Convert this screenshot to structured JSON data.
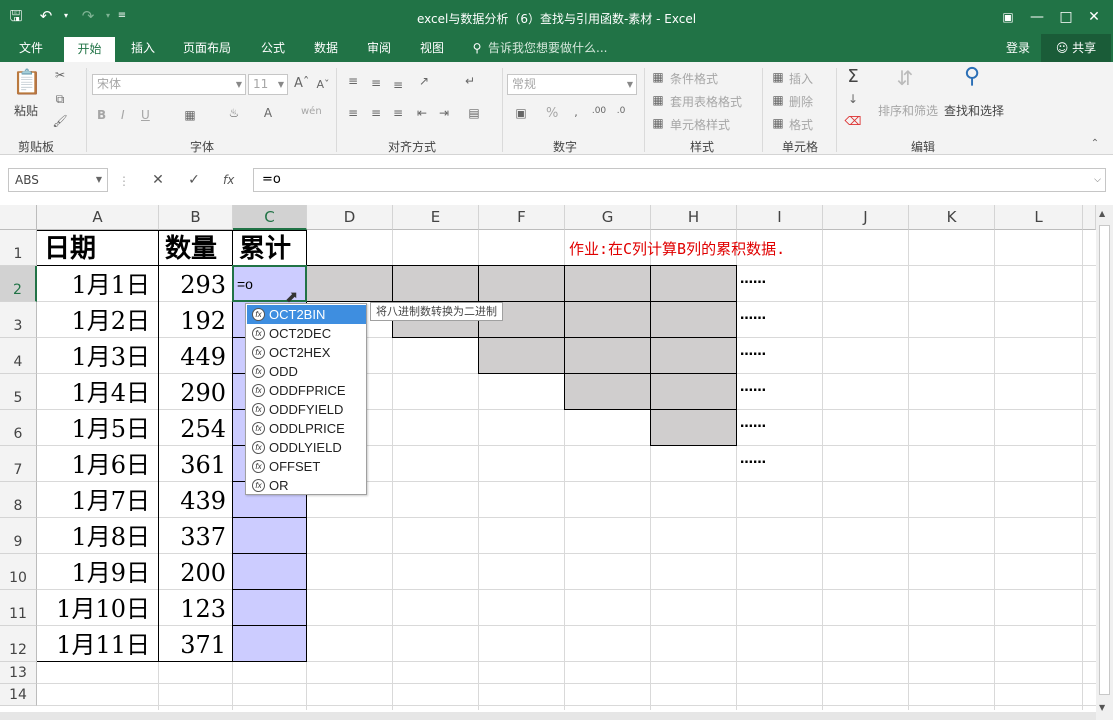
{
  "window": {
    "title": "excel与数据分析（6）查找与引用函数-素材 - Excel"
  },
  "tabs": [
    "文件",
    "开始",
    "插入",
    "页面布局",
    "公式",
    "数据",
    "审阅",
    "视图"
  ],
  "tell_me": "告诉我您想要做什么...",
  "account": {
    "login": "登录",
    "share": "共享"
  },
  "ribbon": {
    "clipboard": {
      "paste": "粘贴",
      "label": "剪贴板"
    },
    "font": {
      "name": "宋体",
      "size": "11",
      "label": "字体",
      "bold": "B",
      "italic": "I",
      "underline": "U",
      "pinyin": "wén"
    },
    "alignment": {
      "label": "对齐方式"
    },
    "number": {
      "format": "常规",
      "percent": "%",
      "label": "数字"
    },
    "styles": {
      "conditional": "条件格式",
      "table": "套用表格格式",
      "cell": "单元格样式",
      "label": "样式"
    },
    "cells": {
      "insert": "插入",
      "delete": "删除",
      "format": "格式",
      "label": "单元格"
    },
    "editing": {
      "sort": "排序和筛选",
      "find": "查找和选择",
      "label": "编辑"
    }
  },
  "formula_bar": {
    "name_box": "ABS",
    "fx": "fx",
    "formula": "=o"
  },
  "columns": [
    "A",
    "B",
    "C",
    "D",
    "E",
    "F",
    "G",
    "H",
    "I",
    "J",
    "K",
    "L"
  ],
  "rows": [
    "1",
    "2",
    "3",
    "4",
    "5",
    "6",
    "7",
    "8",
    "9",
    "10",
    "11",
    "12",
    "13",
    "14"
  ],
  "sheet": {
    "headers": {
      "A": "日期",
      "B": "数量",
      "C": "累计"
    },
    "dates": [
      "1月1日",
      "1月2日",
      "1月3日",
      "1月4日",
      "1月5日",
      "1月6日",
      "1月7日",
      "1月8日",
      "1月9日",
      "1月10日",
      "1月11日"
    ],
    "quantities": [
      "293",
      "192",
      "449",
      "290",
      "254",
      "361",
      "439",
      "337",
      "200",
      "123",
      "371"
    ],
    "active_cell_text": "=o",
    "task_note": "作业:在C列计算B列的累积数据.",
    "ellipsis": "……"
  },
  "autocomplete": {
    "items": [
      "OCT2BIN",
      "OCT2DEC",
      "OCT2HEX",
      "ODD",
      "ODDFPRICE",
      "ODDFYIELD",
      "ODDLPRICE",
      "ODDLYIELD",
      "OFFSET",
      "OR"
    ],
    "selected": 0,
    "tooltip": "将八进制数转换为二进制"
  },
  "colors": {
    "brand": "#217346",
    "task_note": "#e00000",
    "highlight_cells": "#ccccff",
    "gray_cells": "#d0cece"
  }
}
